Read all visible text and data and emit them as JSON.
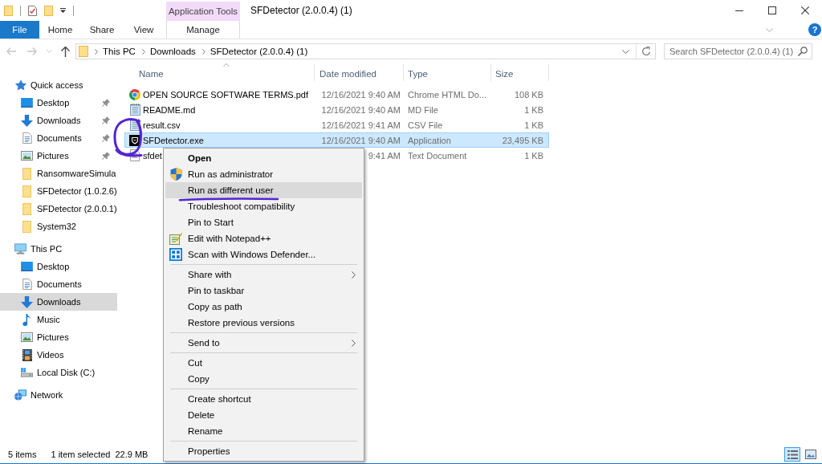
{
  "window": {
    "title": "SFDetector (2.0.0.4) (1)"
  },
  "ribbon": {
    "contextual_group": "Application Tools",
    "tabs": [
      {
        "label": "File",
        "kind": "file"
      },
      {
        "label": "Home",
        "kind": "tab"
      },
      {
        "label": "Share",
        "kind": "tab"
      },
      {
        "label": "View",
        "kind": "tab"
      },
      {
        "label": "Manage",
        "kind": "contextual"
      }
    ],
    "help_button": "?"
  },
  "navigation_buttons": [
    {
      "kind": "back",
      "disabled": true
    },
    {
      "kind": "forward",
      "disabled": true
    },
    {
      "kind": "recent",
      "disabled": true
    },
    {
      "kind": "up",
      "disabled": false
    }
  ],
  "address_bar": {
    "path": [
      "This PC",
      "Downloads",
      "SFDetector (2.0.0.4) (1)"
    ]
  },
  "search": {
    "placeholder": "Search SFDetector (2.0.0.4) (1)"
  },
  "navigation": {
    "sections": [
      {
        "label": "Quick access",
        "kind": "star",
        "selected": false,
        "children": [
          {
            "label": "Desktop",
            "kind": "desktop",
            "pinned": true,
            "selected": false
          },
          {
            "label": "Downloads",
            "kind": "downloads",
            "pinned": true,
            "selected": false
          },
          {
            "label": "Documents",
            "kind": "documents",
            "pinned": true,
            "selected": false
          },
          {
            "label": "Pictures",
            "kind": "pictures",
            "pinned": true,
            "selected": false
          },
          {
            "label": "RansomwareSimula",
            "kind": "folder",
            "pinned": false,
            "selected": false
          },
          {
            "label": "SFDetector (1.0.2.6)",
            "kind": "folder",
            "pinned": false,
            "selected": false
          },
          {
            "label": "SFDetector (2.0.0.1)",
            "kind": "folder",
            "pinned": false,
            "selected": false
          },
          {
            "label": "System32",
            "kind": "folder",
            "pinned": false,
            "selected": false
          }
        ]
      },
      {
        "label": "This PC",
        "kind": "pc",
        "selected": false,
        "children": [
          {
            "label": "Desktop",
            "kind": "desktop",
            "pinned": false,
            "selected": false
          },
          {
            "label": "Documents",
            "kind": "documents",
            "pinned": false,
            "selected": false
          },
          {
            "label": "Downloads",
            "kind": "downloads",
            "pinned": false,
            "selected": true
          },
          {
            "label": "Music",
            "kind": "music",
            "pinned": false,
            "selected": false
          },
          {
            "label": "Pictures",
            "kind": "pictures",
            "pinned": false,
            "selected": false
          },
          {
            "label": "Videos",
            "kind": "videos",
            "pinned": false,
            "selected": false
          },
          {
            "label": "Local Disk (C:)",
            "kind": "drive",
            "pinned": false,
            "selected": false
          }
        ]
      },
      {
        "label": "Network",
        "kind": "network",
        "selected": false
      }
    ]
  },
  "files": {
    "columns": [
      {
        "label": "Name",
        "sorted": true
      },
      {
        "label": "Date modified",
        "sorted": false
      },
      {
        "label": "Type",
        "sorted": false
      },
      {
        "label": "Size",
        "sorted": false
      }
    ],
    "rows": [
      {
        "name": "OPEN SOURCE SOFTWARE TERMS.pdf",
        "date": "12/16/2021 9:40 AM",
        "type": "Chrome HTML Do...",
        "size": "108 KB",
        "kind": "chrome",
        "selected": false
      },
      {
        "name": "README.md",
        "date": "12/16/2021 9:40 AM",
        "type": "MD File",
        "size": "1 KB",
        "kind": "text",
        "selected": false
      },
      {
        "name": "result.csv",
        "date": "12/16/2021 9:41 AM",
        "type": "CSV File",
        "size": "1 KB",
        "kind": "text",
        "selected": false
      },
      {
        "name": "SFDetector.exe",
        "date": "12/16/2021 9:40 AM",
        "type": "Application",
        "size": "23,495 KB",
        "kind": "application",
        "selected": true
      },
      {
        "name": "sfdet",
        "date": "9:41 AM",
        "type": "Text Document",
        "size": "1 KB",
        "kind": "document",
        "selected": false
      }
    ]
  },
  "context_menu": {
    "groups": [
      {
        "items": [
          {
            "label": "Open",
            "kind": "plain",
            "default": true,
            "submenu": false,
            "selected": false
          },
          {
            "label": "Run as administrator",
            "kind": "shield",
            "default": false,
            "submenu": false,
            "selected": false
          },
          {
            "label": "Run as different user",
            "kind": "plain",
            "default": false,
            "submenu": false,
            "selected": true
          },
          {
            "label": "Troubleshoot compatibility",
            "kind": "plain",
            "default": false,
            "submenu": false,
            "selected": false
          },
          {
            "label": "Pin to Start",
            "kind": "plain",
            "default": false,
            "submenu": false,
            "selected": false
          },
          {
            "label": "Edit with Notepad++",
            "kind": "notepad",
            "default": false,
            "submenu": false,
            "selected": false
          },
          {
            "label": "Scan with Windows Defender...",
            "kind": "defender",
            "default": false,
            "submenu": false,
            "selected": false
          }
        ]
      },
      {
        "items": [
          {
            "label": "Share with",
            "kind": "plain",
            "default": false,
            "submenu": true,
            "selected": false
          },
          {
            "label": "Pin to taskbar",
            "kind": "plain",
            "default": false,
            "submenu": false,
            "selected": false
          },
          {
            "label": "Copy as path",
            "kind": "plain",
            "default": false,
            "submenu": false,
            "selected": false
          },
          {
            "label": "Restore previous versions",
            "kind": "plain",
            "default": false,
            "submenu": false,
            "selected": false
          }
        ]
      },
      {
        "items": [
          {
            "label": "Send to",
            "kind": "plain",
            "default": false,
            "submenu": true,
            "selected": false
          }
        ]
      },
      {
        "items": [
          {
            "label": "Cut",
            "kind": "plain",
            "default": false,
            "submenu": false,
            "selected": false
          },
          {
            "label": "Copy",
            "kind": "plain",
            "default": false,
            "submenu": false,
            "selected": false
          }
        ]
      },
      {
        "items": [
          {
            "label": "Create shortcut",
            "kind": "plain",
            "default": false,
            "submenu": false,
            "selected": false
          },
          {
            "label": "Delete",
            "kind": "plain",
            "default": false,
            "submenu": false,
            "selected": false
          },
          {
            "label": "Rename",
            "kind": "plain",
            "default": false,
            "submenu": false,
            "selected": false
          }
        ]
      },
      {
        "items": [
          {
            "label": "Properties",
            "kind": "plain",
            "default": false,
            "submenu": false,
            "selected": false
          }
        ]
      }
    ]
  },
  "status_bar": {
    "item_count": "5 items",
    "selection": "1 item selected",
    "selection_size": "22.9 MB",
    "views": [
      {
        "kind": "details",
        "selected": true
      },
      {
        "kind": "large-icons",
        "selected": false
      }
    ]
  }
}
